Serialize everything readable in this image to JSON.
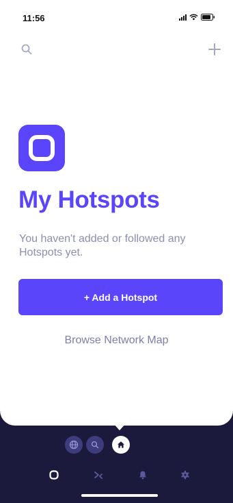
{
  "status_bar": {
    "time": "11:56"
  },
  "header": {
    "search_icon": "search-icon",
    "add_icon": "plus-icon"
  },
  "main": {
    "app_icon": "hotspot-logo-icon",
    "title": "My Hotspots",
    "subtitle": "You haven't added or followed any Hotspots yet.",
    "add_button_label": "+ Add a Hotspot",
    "browse_link_label": "Browse Network Map"
  },
  "map_toggles": [
    {
      "icon": "globe-icon",
      "selected": false
    },
    {
      "icon": "search-icon",
      "selected": false
    },
    {
      "icon": "home-icon",
      "selected": true
    }
  ],
  "tab_bar": [
    {
      "icon": "hotspot-icon",
      "selected": true
    },
    {
      "icon": "transfer-icon",
      "selected": false
    },
    {
      "icon": "bell-icon",
      "selected": false
    },
    {
      "icon": "gear-icon",
      "selected": false
    }
  ],
  "colors": {
    "accent": "#5b45fb",
    "background_dark": "#1b1a3d",
    "muted_text": "#8a8fb3",
    "toggle_inactive": "#3e3c7a"
  }
}
